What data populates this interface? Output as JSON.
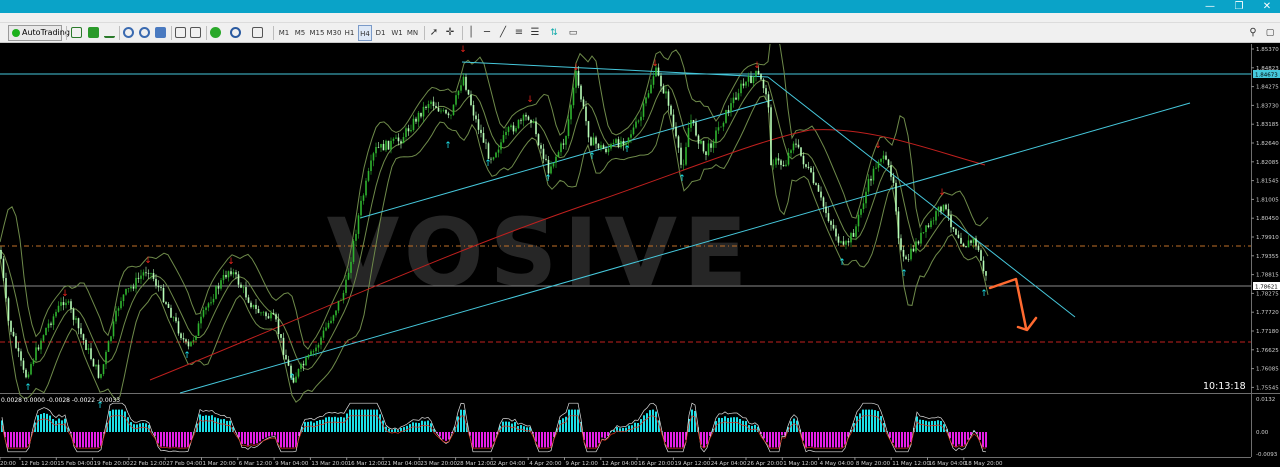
{
  "window": {
    "controls": [
      "—",
      "❐",
      "✕"
    ]
  },
  "toolbar": {
    "autotrading_label": "AutoTrading",
    "timeframes": [
      "M1",
      "M5",
      "M15",
      "M30",
      "H1",
      "H4",
      "D1",
      "W1",
      "MN"
    ],
    "active_timeframe": "H4"
  },
  "watermark": "VOSIVE",
  "clock": "10:13:18",
  "indicator_header": "0.0028 0.0000 -0.0028 -0.0022 -0.0033",
  "price_axis": {
    "labels": [
      "1.85370",
      "1.84823",
      "1.84275",
      "1.83730",
      "1.83185",
      "1.82640",
      "1.82085",
      "1.81545",
      "1.81005",
      "1.80450",
      "1.79910",
      "1.79355",
      "1.78815",
      "1.78275",
      "1.77720",
      "1.77180",
      "1.76625",
      "1.76085",
      "1.75545"
    ],
    "current_price": "1.84673",
    "bid_price": "1.78621"
  },
  "indicator_axis": {
    "labels": [
      "0.0132",
      "0.00",
      "-0.0093"
    ]
  },
  "time_axis": {
    "labels": [
      "20:00",
      "12 Feb 12:00",
      "15 Feb 04:00",
      "19 Feb 20:00",
      "22 Feb 12:00",
      "27 Feb 04:00",
      "1 Mar 20:00",
      "6 Mar 12:00",
      "9 Mar 04:00",
      "13 Mar 20:00",
      "16 Mar 12:00",
      "21 Mar 04:00",
      "23 Mar 20:00",
      "28 Mar 12:00",
      "2 Apr 04:00",
      "4 Apr 20:00",
      "9 Apr 12:00",
      "12 Apr 04:00",
      "16 Apr 20:00",
      "19 Apr 12:00",
      "24 Apr 04:00",
      "26 Apr 20:00",
      "1 May 12:00",
      "4 May 04:00",
      "8 May 20:00",
      "11 May 12:00",
      "16 May 04:00",
      "18 May 20:00"
    ]
  },
  "colors": {
    "title_bar": "#0aa3c8",
    "trendline": "#46c8dc",
    "moving_average": "#c0201e",
    "bollinger": "#6e8a4a",
    "bull_candle": "#2fb52f",
    "bear_candle": "#b8ffb8",
    "fractal_up": "#1de0e8",
    "fractal_down": "#e8241c",
    "forecast_arrow": "#ff6a30",
    "histogram": "#e61ee6"
  }
}
